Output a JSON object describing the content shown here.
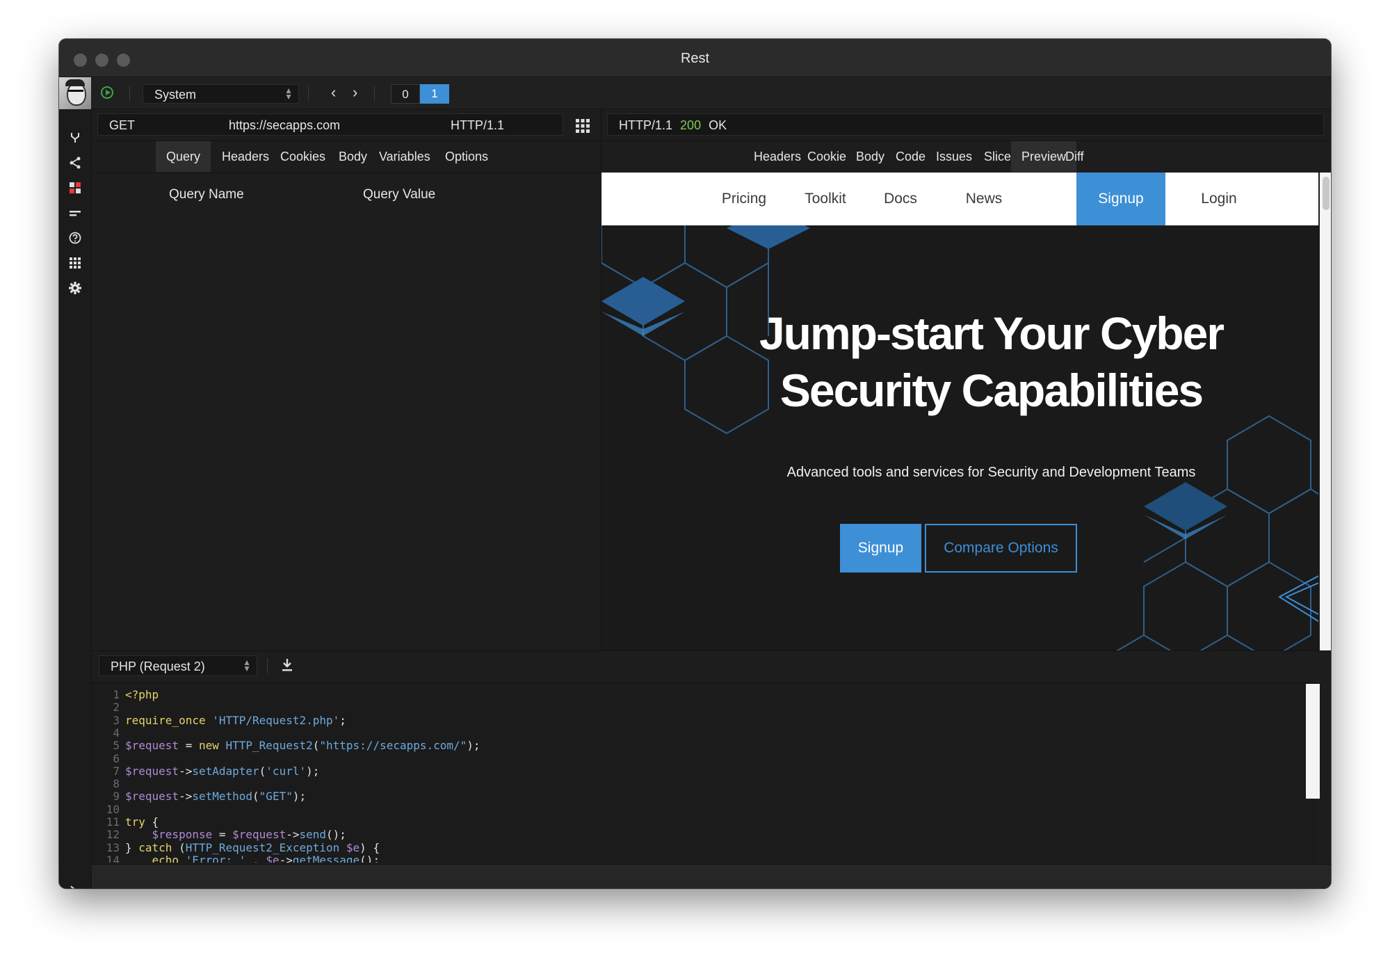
{
  "window": {
    "title": "Rest"
  },
  "toolbar": {
    "environment": "System",
    "counters": [
      "0",
      "1"
    ],
    "active_counter": "1"
  },
  "request": {
    "method": "GET",
    "url": "https://secapps.com",
    "protocol": "HTTP/1.1"
  },
  "request_tabs": [
    "Query",
    "Headers",
    "Cookies",
    "Body",
    "Variables",
    "Options"
  ],
  "query_table": {
    "headers": [
      "Query Name",
      "Query Value"
    ]
  },
  "response": {
    "protocol": "HTTP/1.1",
    "status_code": "200",
    "status_text": "OK"
  },
  "response_tabs": [
    "Headers",
    "Cookie",
    "Body",
    "Code",
    "Issues",
    "Slice",
    "Preview",
    "Diff"
  ],
  "preview": {
    "nav": [
      "Pricing",
      "Toolkit",
      "Docs",
      "News",
      "Signup",
      "Login"
    ],
    "headline_1": "Jump-start Your Cyber",
    "headline_2": "Security Capabilities",
    "subheading": "Advanced tools and services for Security and Development Teams",
    "signup_label": "Signup",
    "compare_label": "Compare Options"
  },
  "codegen": {
    "language": "PHP (Request 2)"
  },
  "code_lines": [
    [
      [
        "k",
        "<?php"
      ]
    ],
    [],
    [
      [
        "k",
        "require_once "
      ],
      [
        "s",
        "'HTTP/Request2.php'"
      ],
      [
        "t",
        ";"
      ]
    ],
    [],
    [
      [
        "v",
        "$request"
      ],
      [
        "t",
        " = "
      ],
      [
        "k",
        "new "
      ],
      [
        "f",
        "HTTP_Request2"
      ],
      [
        "t",
        "("
      ],
      [
        "s",
        "\"https://secapps.com/\""
      ],
      [
        "t",
        ");"
      ]
    ],
    [],
    [
      [
        "v",
        "$request"
      ],
      [
        "t",
        "->"
      ],
      [
        "f",
        "setAdapter"
      ],
      [
        "t",
        "("
      ],
      [
        "s",
        "'curl'"
      ],
      [
        "t",
        ");"
      ]
    ],
    [],
    [
      [
        "v",
        "$request"
      ],
      [
        "t",
        "->"
      ],
      [
        "f",
        "setMethod"
      ],
      [
        "t",
        "("
      ],
      [
        "s",
        "\"GET\""
      ],
      [
        "t",
        ");"
      ]
    ],
    [],
    [
      [
        "k",
        "try "
      ],
      [
        "t",
        "{"
      ]
    ],
    [
      [
        "t",
        "    "
      ],
      [
        "v",
        "$response"
      ],
      [
        "t",
        " = "
      ],
      [
        "v",
        "$request"
      ],
      [
        "t",
        "->"
      ],
      [
        "f",
        "send"
      ],
      [
        "t",
        "();"
      ]
    ],
    [
      [
        "t",
        "} "
      ],
      [
        "k",
        "catch "
      ],
      [
        "t",
        "("
      ],
      [
        "f",
        "HTTP_Request2_Exception"
      ],
      [
        "t",
        " "
      ],
      [
        "v",
        "$e"
      ],
      [
        "t",
        ") {"
      ]
    ],
    [
      [
        "t",
        "    "
      ],
      [
        "k",
        "echo "
      ],
      [
        "s",
        "'Error: '"
      ],
      [
        "t",
        " . "
      ],
      [
        "v",
        "$e"
      ],
      [
        "t",
        "->"
      ],
      [
        "f",
        "getMessage"
      ],
      [
        "t",
        "();"
      ]
    ]
  ],
  "colors": {
    "accent": "#3d8fd6",
    "status_ok": "#7ec850",
    "play": "#3fa14a"
  },
  "icons": [
    "play-icon",
    "branch-icon",
    "share-icon",
    "dashboard-icon",
    "lines-icon",
    "help-icon",
    "apps-icon",
    "gear-icon",
    "chevron-right-icon",
    "grid-icon",
    "download-icon",
    "back-arrow-icon",
    "forward-arrow-icon"
  ]
}
